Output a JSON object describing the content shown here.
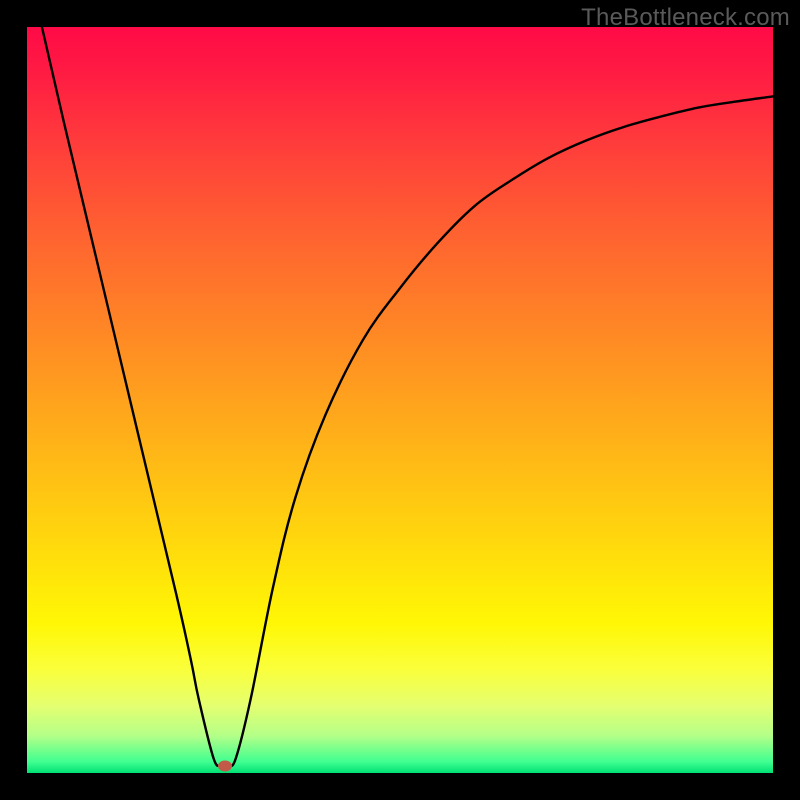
{
  "watermark": "TheBottleneck.com",
  "colors": {
    "gradient_stops": [
      {
        "offset": 0.0,
        "color": "#ff0a46"
      },
      {
        "offset": 0.06,
        "color": "#ff1b43"
      },
      {
        "offset": 0.15,
        "color": "#ff3a3c"
      },
      {
        "offset": 0.28,
        "color": "#ff6330"
      },
      {
        "offset": 0.42,
        "color": "#ff8b24"
      },
      {
        "offset": 0.56,
        "color": "#ffb318"
      },
      {
        "offset": 0.7,
        "color": "#ffdb0c"
      },
      {
        "offset": 0.8,
        "color": "#fff705"
      },
      {
        "offset": 0.86,
        "color": "#faff3a"
      },
      {
        "offset": 0.91,
        "color": "#e4ff70"
      },
      {
        "offset": 0.95,
        "color": "#b4ff88"
      },
      {
        "offset": 0.985,
        "color": "#40ff90"
      },
      {
        "offset": 1.0,
        "color": "#00e074"
      }
    ],
    "curve": "#000000",
    "marker": "#c25a4a",
    "background": "#000000"
  },
  "chart_data": {
    "type": "line",
    "title": "",
    "xlabel": "",
    "ylabel": "",
    "xlim": [
      0,
      100
    ],
    "ylim": [
      0,
      100
    ],
    "grid": false,
    "series": [
      {
        "name": "curve",
        "x": [
          2,
          5,
          10,
          15,
          20,
          22,
          23,
          25,
          26,
          27,
          28,
          30,
          33,
          36,
          40,
          45,
          50,
          55,
          60,
          65,
          70,
          75,
          80,
          85,
          90,
          95,
          100
        ],
        "y": [
          100,
          87,
          66,
          45,
          24,
          15,
          10,
          2,
          1,
          1,
          2,
          10,
          25,
          37,
          48,
          58,
          65,
          71,
          76,
          79.5,
          82.5,
          84.8,
          86.6,
          88,
          89.2,
          90,
          90.7
        ]
      }
    ],
    "marker_point": {
      "x": 26.5,
      "y": 1
    },
    "note": "x/y are percentages of the visible plot area; y is measured from the bottom (0) to top (100)."
  }
}
